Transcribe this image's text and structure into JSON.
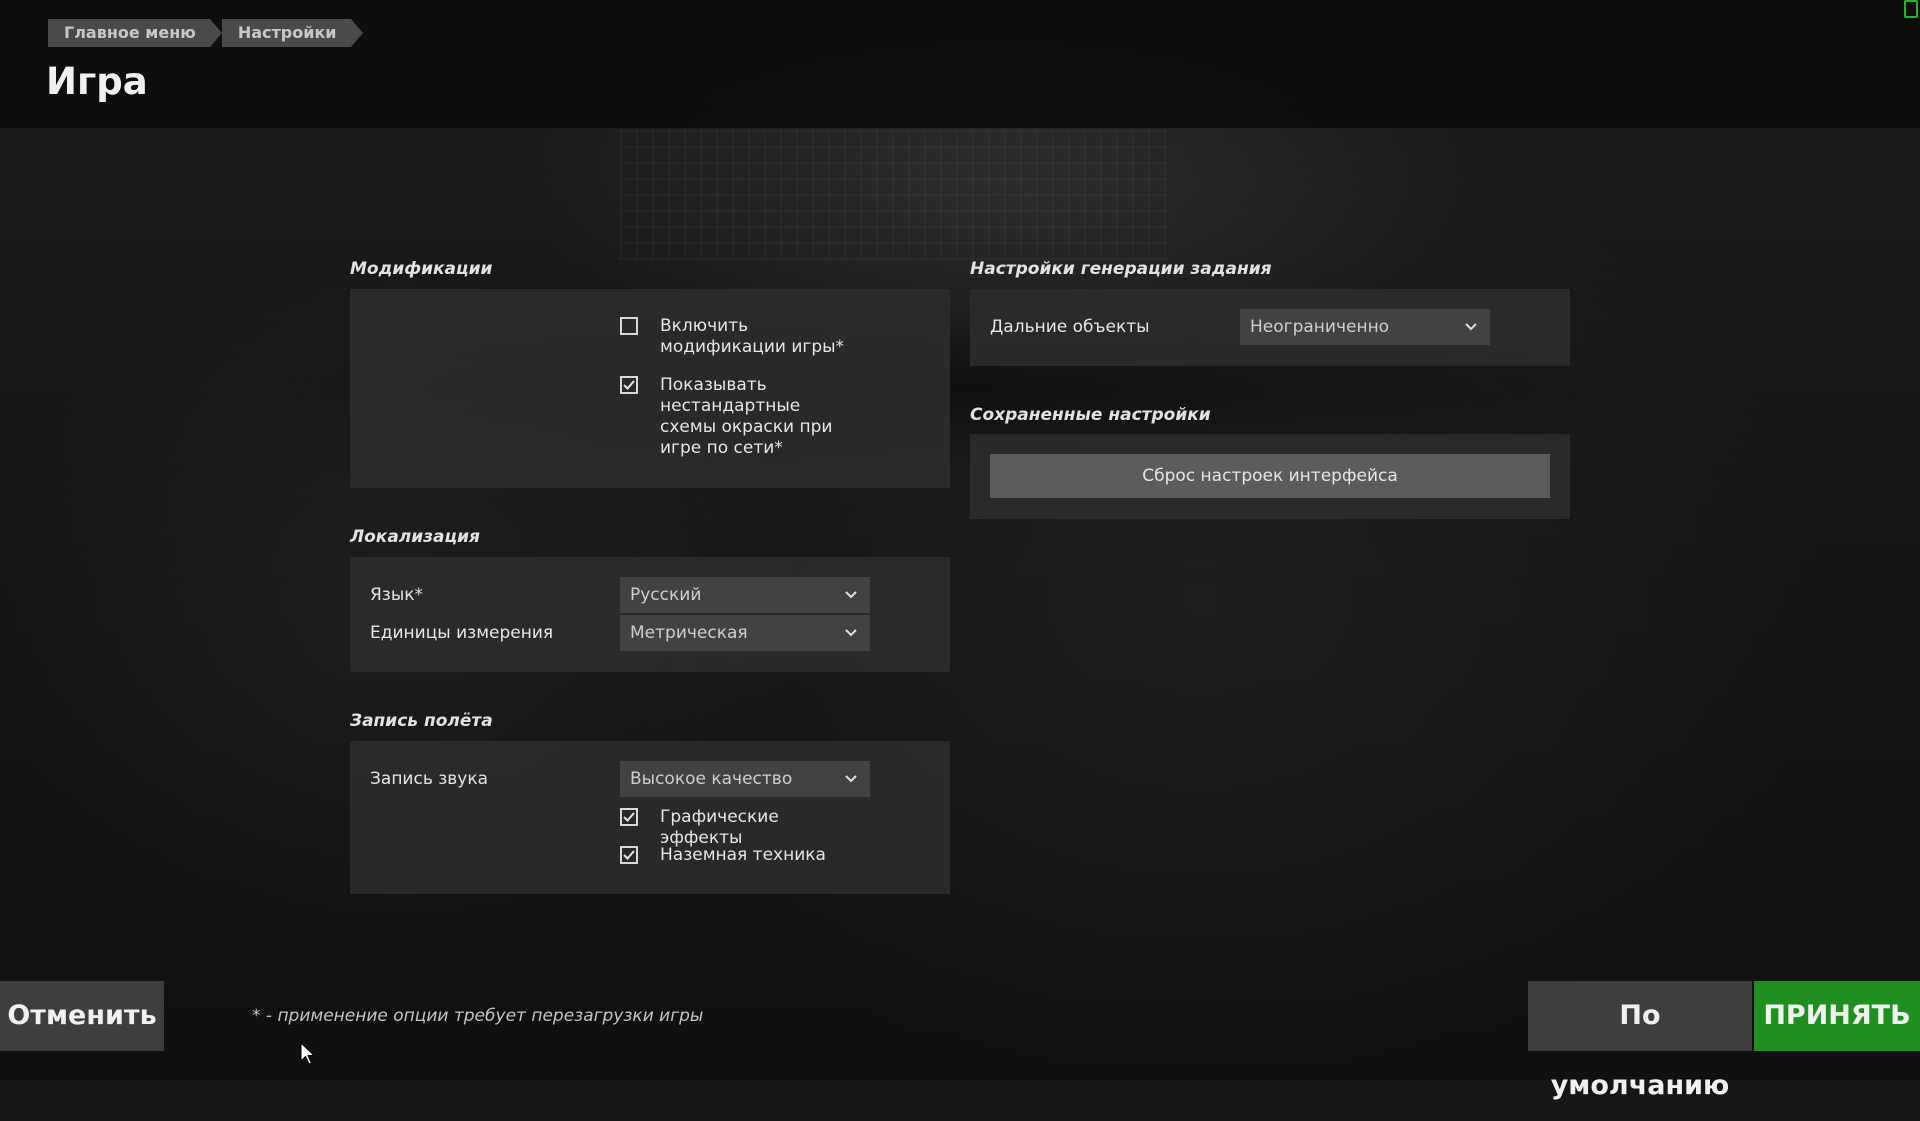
{
  "header": {
    "breadcrumb": [
      "Главное меню",
      "Настройки"
    ],
    "title": "Игра"
  },
  "mods": {
    "section_title": "Модификации",
    "enable_mods": {
      "label": "Включить модификации игры*",
      "checked": false
    },
    "show_skins": {
      "label": "Показывать нестандартные схемы окраски при игре по сети*",
      "checked": true
    }
  },
  "localization": {
    "section_title": "Локализация",
    "language": {
      "label": "Язык*",
      "value": "Русский"
    },
    "units": {
      "label": "Единицы измерения",
      "value": "Метрическая"
    }
  },
  "flight_record": {
    "section_title": "Запись полёта",
    "sound": {
      "label": "Запись звука",
      "value": "Высокое качество"
    },
    "graphics_effects": {
      "label": "Графические эффекты",
      "checked": true
    },
    "ground_vehicles": {
      "label": "Наземная техника",
      "checked": true
    }
  },
  "mission_gen": {
    "section_title": "Настройки генерации задания",
    "far_objects": {
      "label": "Дальние объекты",
      "value": "Неограниченно"
    }
  },
  "saved_settings": {
    "section_title": "Сохраненные настройки",
    "reset_label": "Сброс настроек интерфейса"
  },
  "footer": {
    "cancel": "Отменить",
    "note": "* - применение опции требует перезагрузки игры",
    "default": "По умолчанию",
    "accept": "ПРИНЯТЬ"
  },
  "colors": {
    "accept": "#1f8f1f",
    "panel": "#2c2c2c",
    "dropdown": "#424242"
  },
  "icons": {
    "dropdown": "chevron-down-icon",
    "checkbox_checked": "checkmark-icon",
    "cursor": "mouse-pointer-icon"
  }
}
